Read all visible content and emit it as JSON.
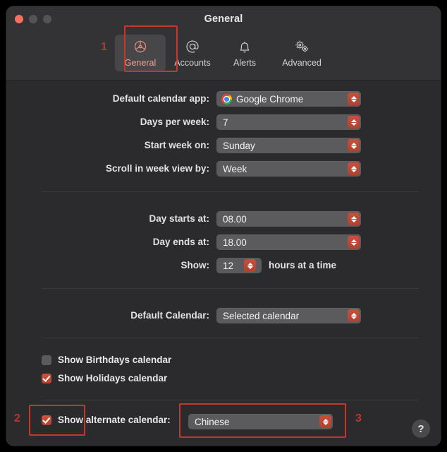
{
  "window": {
    "title": "General",
    "traffic_lights": [
      "close-button",
      "minimize-button",
      "zoom-button"
    ]
  },
  "toolbar": {
    "tabs": [
      {
        "label": "General",
        "icon": "gear-icon",
        "selected": true
      },
      {
        "label": "Accounts",
        "icon": "at-sign-icon",
        "selected": false
      },
      {
        "label": "Alerts",
        "icon": "bell-icon",
        "selected": false
      },
      {
        "label": "Advanced",
        "icon": "double-gear-icon",
        "selected": false
      }
    ]
  },
  "settings": {
    "group1": [
      {
        "label": "Default calendar app:",
        "value": "Google Chrome",
        "icon": "chrome-icon"
      },
      {
        "label": "Days per week:",
        "value": "7"
      },
      {
        "label": "Start week on:",
        "value": "Sunday"
      },
      {
        "label": "Scroll in week view by:",
        "value": "Week"
      }
    ],
    "group2": [
      {
        "label": "Day starts at:",
        "value": "08.00"
      },
      {
        "label": "Day ends at:",
        "value": "18.00"
      }
    ],
    "show_hours": {
      "label": "Show:",
      "value": "12",
      "suffix": "hours at a time"
    },
    "default_calendar": {
      "label": "Default Calendar:",
      "value": "Selected calendar"
    },
    "checkboxes": [
      {
        "label": "Show Birthdays calendar",
        "checked": false
      },
      {
        "label": "Show Holidays calendar",
        "checked": true
      }
    ],
    "alternate_calendar": {
      "label": "Show alternate calendar:",
      "checked": true,
      "value": "Chinese"
    }
  },
  "help": {
    "glyph": "?"
  },
  "annotations": [
    {
      "number": "1",
      "target": "general-tab"
    },
    {
      "number": "2",
      "target": "show-alternate-calendar-checkbox"
    },
    {
      "number": "3",
      "target": "alternate-calendar-popup"
    }
  ],
  "colors": {
    "accent": "#c6503c",
    "annotation": "#c0392b",
    "window_bg": "#2b2b2d",
    "titlebar_bg": "#333335"
  }
}
